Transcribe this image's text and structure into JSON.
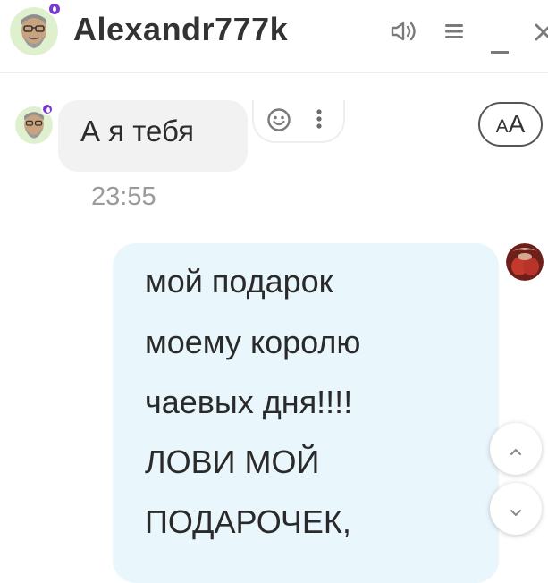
{
  "header": {
    "title": "Alexandr777k",
    "icons": [
      "avatar",
      "premium-badge-icon",
      "speaker-icon",
      "menu-icon",
      "minimize-icon",
      "close-icon"
    ]
  },
  "messages": {
    "incoming": {
      "text": "А я тебя",
      "time": "23:55",
      "actions": [
        "emoji-icon",
        "more-icon"
      ]
    },
    "outgoing": {
      "lines": [
        "мой подарок",
        "моему королю",
        "чаевых дня!!!!",
        "ЛОВИ МОЙ",
        "ПОДАРОЧЕК,"
      ]
    }
  },
  "font_size_button": {
    "big": "A",
    "small": "A"
  },
  "scroll": {
    "up": "chevron-up-icon",
    "down": "chevron-down-icon"
  },
  "colors": {
    "incoming_bubble": "#f2f2f2",
    "outgoing_bubble": "#e9f6fc",
    "badge": "#7a3ad1",
    "time": "#9a9a9a"
  }
}
